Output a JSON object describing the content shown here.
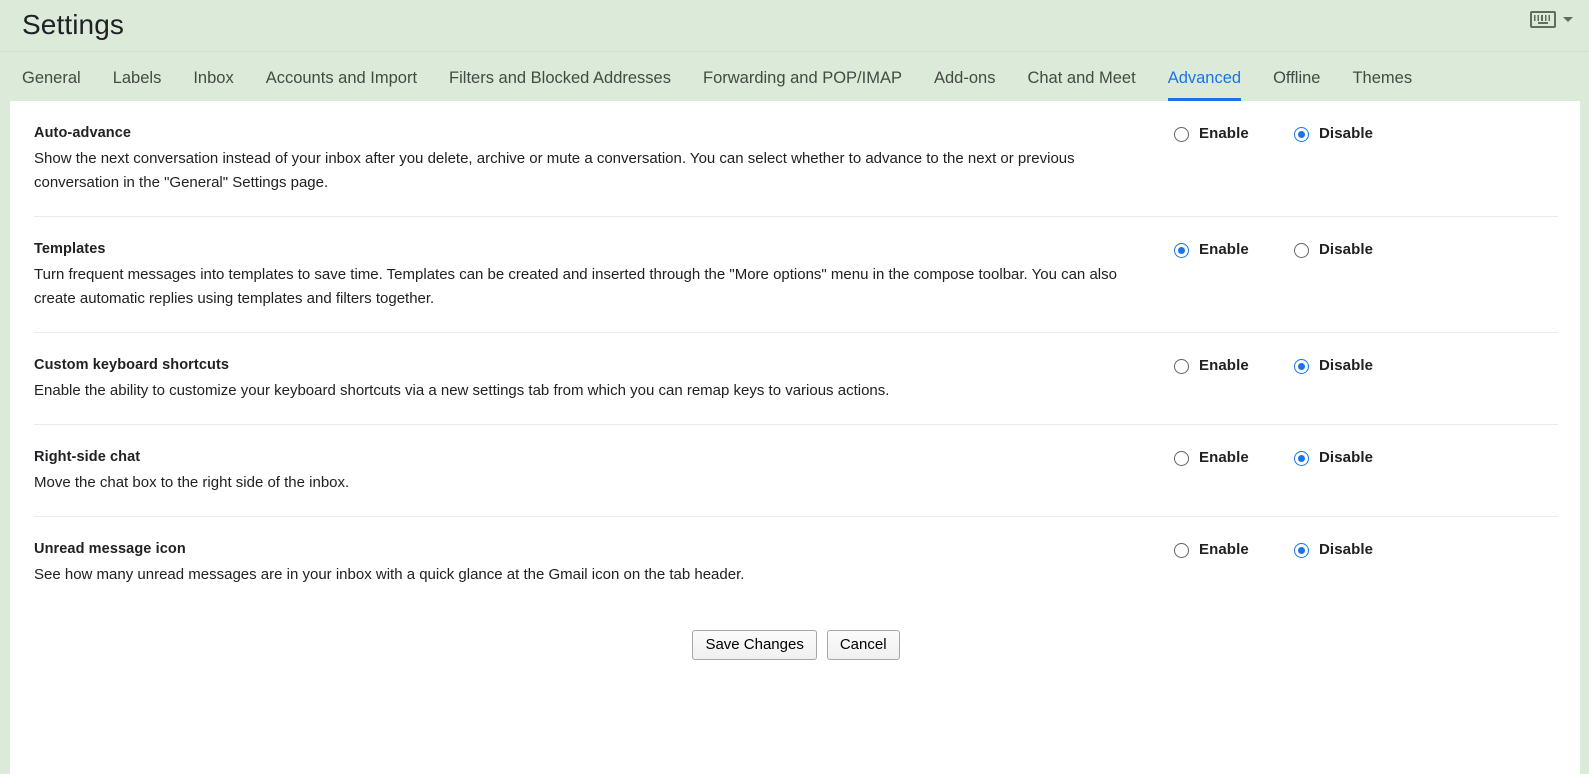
{
  "header": {
    "title": "Settings",
    "keyboard_icon": "keyboard-icon",
    "chevron_icon": "chevron-down-icon"
  },
  "tabs": [
    {
      "label": "General",
      "active": false
    },
    {
      "label": "Labels",
      "active": false
    },
    {
      "label": "Inbox",
      "active": false
    },
    {
      "label": "Accounts and Import",
      "active": false
    },
    {
      "label": "Filters and Blocked Addresses",
      "active": false
    },
    {
      "label": "Forwarding and POP/IMAP",
      "active": false
    },
    {
      "label": "Add-ons",
      "active": false
    },
    {
      "label": "Chat and Meet",
      "active": false
    },
    {
      "label": "Advanced",
      "active": true
    },
    {
      "label": "Offline",
      "active": false
    },
    {
      "label": "Themes",
      "active": false
    }
  ],
  "options_labels": {
    "enable": "Enable",
    "disable": "Disable"
  },
  "settings": [
    {
      "title": "Auto-advance",
      "description": "Show the next conversation instead of your inbox after you delete, archive or mute a conversation. You can select whether to advance to the next or previous conversation in the \"General\" Settings page.",
      "selected": "disable"
    },
    {
      "title": "Templates",
      "description": "Turn frequent messages into templates to save time. Templates can be created and inserted through the \"More options\" menu in the compose toolbar. You can also create automatic replies using templates and filters together.",
      "selected": "enable"
    },
    {
      "title": "Custom keyboard shortcuts",
      "description": "Enable the ability to customize your keyboard shortcuts via a new settings tab from which you can remap keys to various actions.",
      "selected": "disable"
    },
    {
      "title": "Right-side chat",
      "description": "Move the chat box to the right side of the inbox.",
      "selected": "disable"
    },
    {
      "title": "Unread message icon",
      "description": "See how many unread messages are in your inbox with a quick glance at the Gmail icon on the tab header.",
      "selected": "disable"
    }
  ],
  "actions": {
    "save_label": "Save Changes",
    "cancel_label": "Cancel"
  },
  "colors": {
    "accent": "#1a73e8",
    "header_bg": "#dbead9",
    "panel_bg": "#ffffff",
    "text": "#202124",
    "tab_text": "#444b44"
  }
}
